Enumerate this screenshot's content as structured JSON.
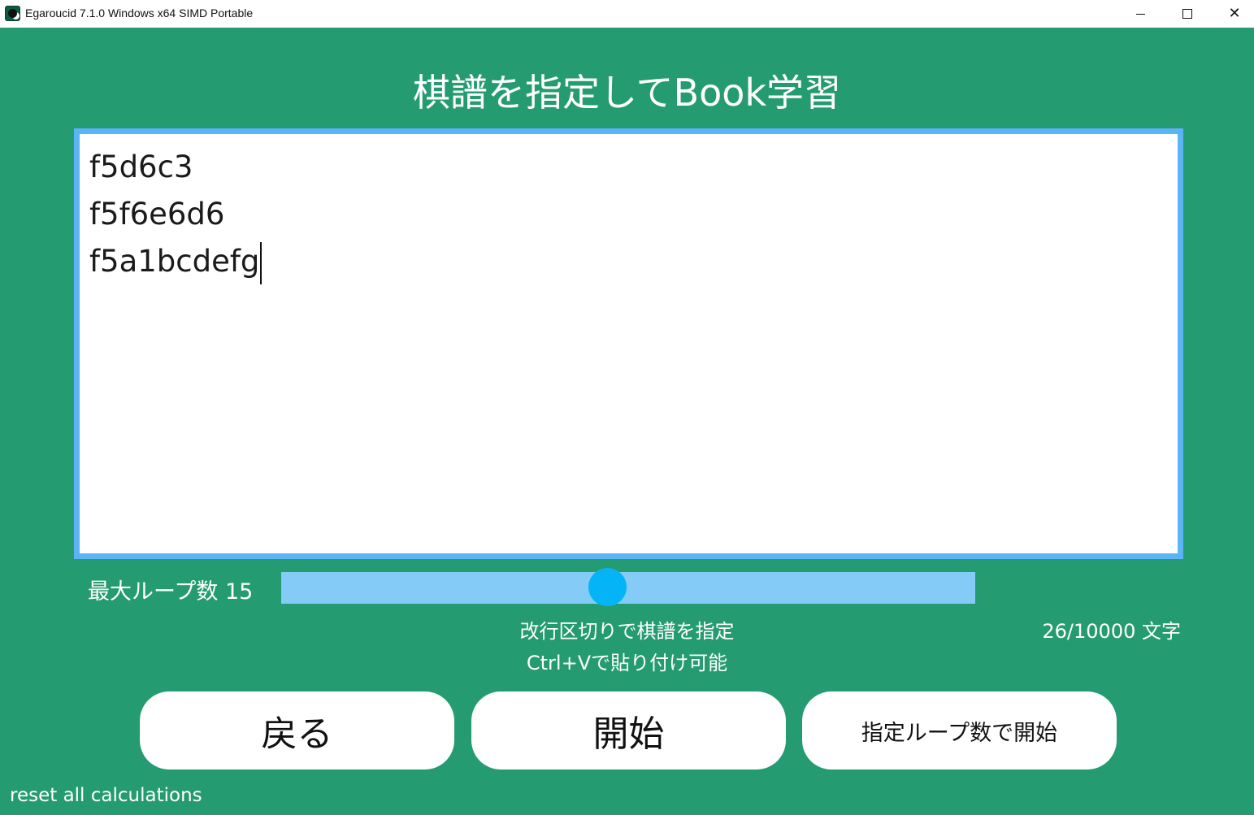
{
  "window": {
    "title": "Egaroucid 7.1.0 Windows x64 SIMD Portable",
    "icon": "egaroucid-app-icon",
    "controls": {
      "minimize": "minimize-icon",
      "maximize": "maximize-icon",
      "close": "close-icon",
      "close_glyph": "✕"
    }
  },
  "page": {
    "title": "棋譜を指定してBook学習"
  },
  "editor": {
    "lines": [
      "f5d6c3",
      "f5f6e6d6",
      "f5a1bcdefg"
    ]
  },
  "loop": {
    "label": "最大ループ数 15",
    "value": 15,
    "slider_fraction": 0.47
  },
  "hints": {
    "line1": "改行区切りで棋譜を指定",
    "line2": "Ctrl+Vで貼り付け可能",
    "char_count": "26/10000 文字"
  },
  "buttons": {
    "back": "戻る",
    "start": "開始",
    "start_with_loop": "指定ループ数で開始"
  },
  "footer": {
    "reset_link": "reset all calculations"
  },
  "colors": {
    "background": "#259b72",
    "editor_border": "#5ab4f6",
    "slider_track": "#84cbf7",
    "slider_knob": "#04b4f6",
    "button_bg": "#ffffff"
  }
}
